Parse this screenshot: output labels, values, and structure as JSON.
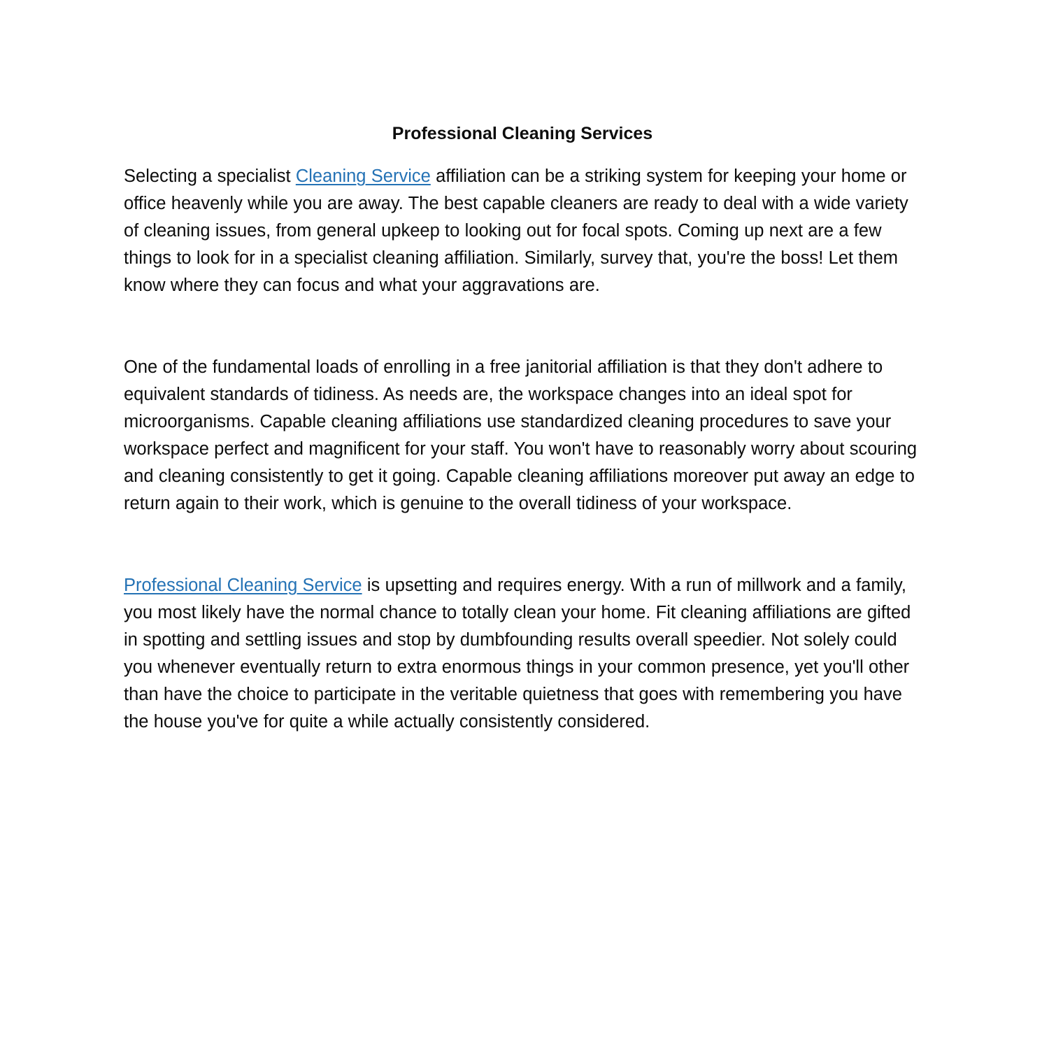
{
  "document": {
    "title": "Professional Cleaning Services",
    "background_color": "#ffffff",
    "text_color": "#0c0c0c",
    "link_color": "#2472b5",
    "paragraphs": [
      {
        "id": "p1",
        "segments": [
          {
            "type": "text",
            "value": "Selecting a specialist "
          },
          {
            "type": "link",
            "value": "Cleaning Service"
          },
          {
            "type": "text",
            "value": " affiliation can be a striking system for keeping your home or office heavenly while you are away. The best capable cleaners are ready to deal with a wide variety of cleaning issues, from general upkeep to looking out for focal spots. Coming up next are a few things to look for in a specialist cleaning affiliation. Similarly, survey that, you're the boss! Let them know where they can focus and what your aggravations are."
          }
        ]
      },
      {
        "id": "p2",
        "segments": [
          {
            "type": "text",
            "value": "One of the fundamental loads of enrolling in a free janitorial affiliation is that they don't adhere to equivalent standards of tidiness. As needs are, the workspace changes into an ideal spot for microorganisms. Capable cleaning affiliations use standardized cleaning procedures to save your workspace perfect and magnificent for your staff. You won't have to reasonably worry about scouring and cleaning consistently to get it going. Capable cleaning affiliations moreover put away an edge to return again to their work, which is genuine to the overall tidiness of your workspace."
          }
        ]
      },
      {
        "id": "p3",
        "segments": [
          {
            "type": "link",
            "value": "Professional Cleaning Service"
          },
          {
            "type": "text",
            "value": " is upsetting and requires energy. With a run of millwork and a family, you most likely have the normal chance to totally clean your home. Fit cleaning affiliations are gifted in spotting and settling issues and stop by dumbfounding results overall speedier. Not solely could you whenever eventually return to extra enormous things in your common presence, yet you'll other than have the choice to participate in the veritable quietness that goes with remembering you have the house you've for quite a while actually consistently considered."
          }
        ]
      }
    ]
  }
}
